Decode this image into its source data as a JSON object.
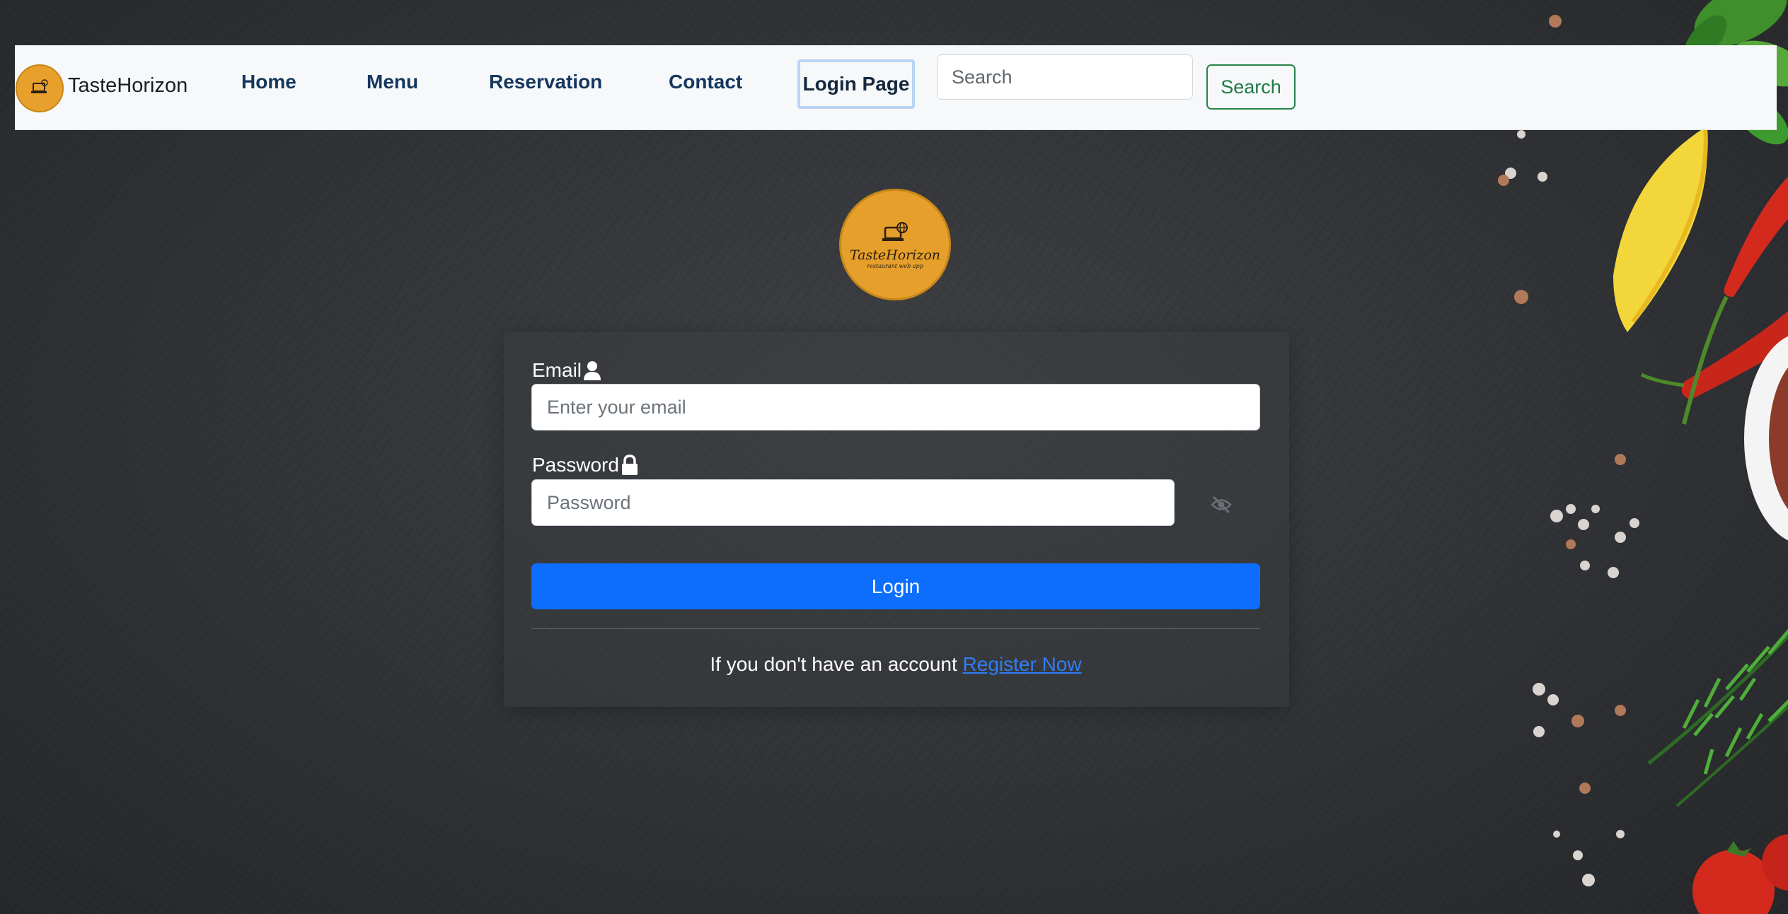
{
  "navbar": {
    "brand_name": "TasteHorizon",
    "links": {
      "home": "Home",
      "menu": "Menu",
      "reservation": "Reservation",
      "contact": "Contact",
      "login": "Login Page"
    },
    "search": {
      "placeholder": "Search",
      "button_label": "Search"
    }
  },
  "logo": {
    "title": "TasteHorizon",
    "subtitle": "restaurant web app"
  },
  "login_form": {
    "email_label": "Email",
    "email_placeholder": "Enter your email",
    "password_label": "Password",
    "password_placeholder": "Password",
    "login_button": "Login",
    "register_prompt": "If you don't have an account",
    "register_link": "Register Now"
  },
  "colors": {
    "primary": "#0d6efd",
    "success": "#1e7a43",
    "logo_orange": "#e69f2b",
    "nav_text": "#15375e"
  },
  "icons": {
    "email": "user-icon",
    "password": "lock-icon",
    "toggle": "eye-slash-icon"
  }
}
